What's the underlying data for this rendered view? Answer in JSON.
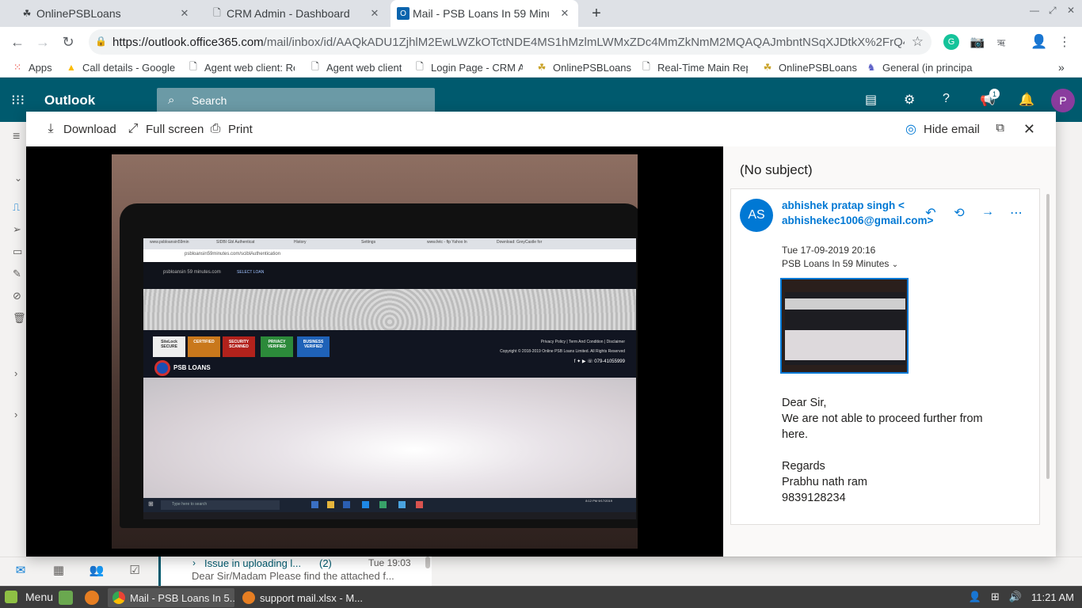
{
  "browser": {
    "tabs": [
      {
        "title": "OnlinePSBLoans",
        "active": false
      },
      {
        "title": "CRM Admin - Dashboard",
        "active": false
      },
      {
        "title": "Mail - PSB Loans In 59 Minutes",
        "active": true
      }
    ],
    "url_host": "https://outlook.office365.com",
    "url_path": "/mail/inbox/id/AAQkADU1ZjhlM2EwLWZkOTctNDE4MS1hMzlmLWMxZDc4MmZkNmM2MQAQAJmbntNSqXJDtkX%2FrQ4...",
    "bookmarks": [
      "Apps",
      "Call details - Google",
      "Agent web client: Re",
      "Agent web client",
      "Login Page - CRM Ad",
      "OnlinePSBLoans",
      "Real-Time Main Rep",
      "OnlinePSBLoans",
      "General (in principal"
    ]
  },
  "outlook": {
    "brand": "Outlook",
    "search_placeholder": "Search",
    "notification_count": "1",
    "user_initial": "P",
    "list_item": {
      "subject": "Issue in uploading l...",
      "count": "(2)",
      "time": "Tue 19:03",
      "preview": "Dear Sir/Madam Please find the attached f..."
    }
  },
  "viewer": {
    "download_label": "Download",
    "fullscreen_label": "Full screen",
    "print_label": "Print",
    "hide_email_label": "Hide email"
  },
  "photo": {
    "tab_labels": [
      "www.psbloansin59min",
      "SIDBI Gbl Authenticat",
      "History",
      "Settings",
      "www.fetc - ftp Yahoo ln",
      "Download: GreyCastle for"
    ],
    "url_text": "psbloansin59minutes.com/sciblAuthentication",
    "logo_text": "psbloansin 59 minutes.com",
    "select_loan": "SELECT LOAN",
    "badges": [
      "SiteLock SECURE",
      "CERTIFIED",
      "SECURITY SCANNED",
      "PRIVACY VERIFIED",
      "BUSINESS VERIFIED"
    ],
    "footer_links": "Privacy Policy  |  Term And Condition  |  Disclaimer",
    "footer_copy": "Copyright © 2018-2019 Online PSB Loans Limited. All Rights Reserved",
    "footer_phone": "079-41055999",
    "footer_brand": "PSB LOANS",
    "taskbar_search": "Type here to search",
    "clock": "8:12 PM\n9/17/2019"
  },
  "email": {
    "subject": "(No subject)",
    "avatar_initials": "AS",
    "sender": "abhishek pratap singh < abhishekec1006@gmail.com>",
    "date": "Tue 17-09-2019 20:16",
    "to": "PSB Loans In 59 Minutes",
    "body_lines": [
      "Dear Sir,",
      "We are not able to proceed further from here.",
      "",
      "Regards",
      "Prabhu nath ram",
      "9839128234"
    ]
  },
  "taskbar": {
    "menu_label": "Menu",
    "windows": [
      {
        "title": "Mail - PSB Loans In 5...",
        "active": true
      },
      {
        "title": "support mail.xlsx - M...",
        "active": false
      }
    ],
    "clock": "11:21 AM"
  },
  "colors": {
    "owa_header": "#005a6e",
    "accent": "#0078d4",
    "chrome_tabstrip": "#dee1e6"
  }
}
